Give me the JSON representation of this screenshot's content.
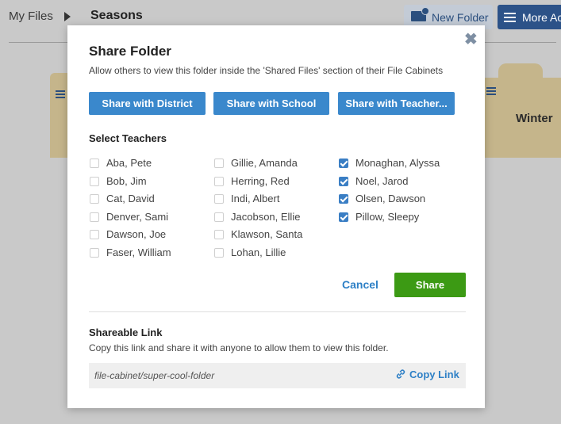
{
  "breadcrumb": {
    "root": "My Files",
    "current": "Seasons"
  },
  "toolbar": {
    "new_folder_label": "New Folder",
    "more_actions_label": "More Act"
  },
  "folders": {
    "right_label": "Winter"
  },
  "modal": {
    "title": "Share Folder",
    "subtitle": "Allow others to view this folder inside the 'Shared Files' section of their File Cabinets",
    "buttons": {
      "district": "Share with District",
      "school": "Share with School",
      "teacher": "Share with Teacher..."
    },
    "select_label": "Select Teachers",
    "teachers": [
      {
        "name": "Aba, Pete",
        "checked": false
      },
      {
        "name": "Bob, Jim",
        "checked": false
      },
      {
        "name": "Cat, David",
        "checked": false
      },
      {
        "name": "Denver, Sami",
        "checked": false
      },
      {
        "name": "Dawson, Joe",
        "checked": false
      },
      {
        "name": "Faser, William",
        "checked": false
      },
      {
        "name": "Gillie, Amanda",
        "checked": false
      },
      {
        "name": "Herring, Red",
        "checked": false
      },
      {
        "name": "Indi, Albert",
        "checked": false
      },
      {
        "name": "Jacobson, Ellie",
        "checked": false
      },
      {
        "name": "Klawson, Santa",
        "checked": false
      },
      {
        "name": "Lohan, Lillie",
        "checked": false
      },
      {
        "name": "Monaghan, Alyssa",
        "checked": true
      },
      {
        "name": "Noel, Jarod",
        "checked": true
      },
      {
        "name": "Olsen, Dawson",
        "checked": true
      },
      {
        "name": "Pillow, Sleepy",
        "checked": true
      }
    ],
    "cancel_label": "Cancel",
    "share_label": "Share",
    "link_section": {
      "title": "Shareable Link",
      "description": "Copy this link and share it with anyone to allow them to view this folder.",
      "value": "file-cabinet/super-cool-folder",
      "copy_label": "Copy Link"
    }
  },
  "colors": {
    "primary": "#3a88cc",
    "success": "#3c9a14",
    "folder": "#c5b58b",
    "checkbox": "#3a7ec4"
  }
}
